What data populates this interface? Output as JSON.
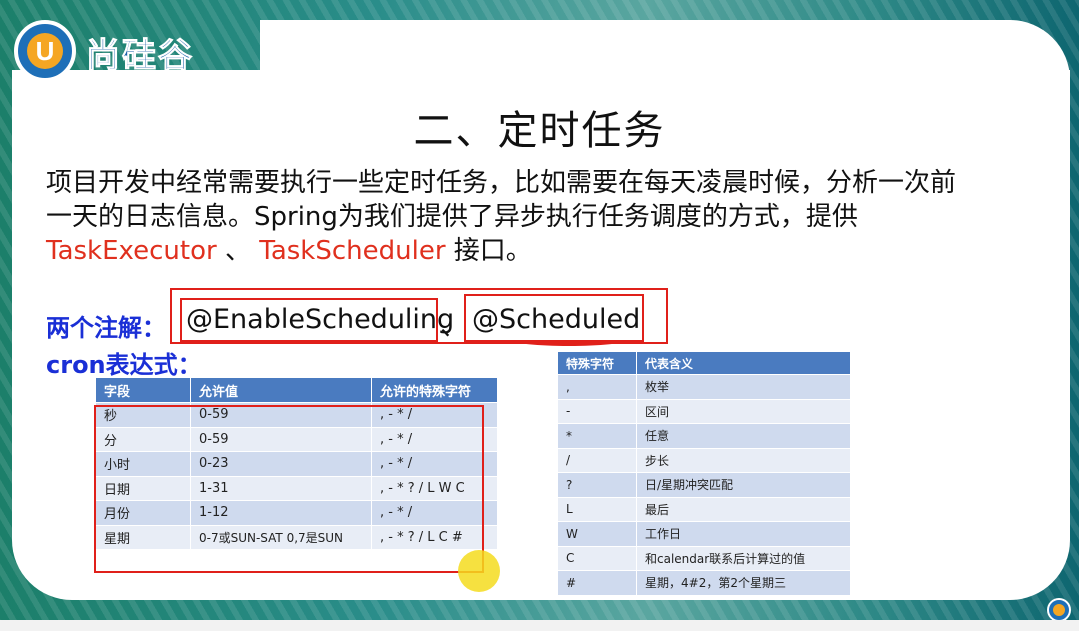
{
  "logo": {
    "badge_letter": "U",
    "name": "尚硅谷",
    "url": "www.atguigu.com"
  },
  "slide": {
    "title": "二、定时任务",
    "paragraph_line1": "项目开发中经常需要执行一些定时任务，比如需要在每天凌晨时候，分析一次前",
    "paragraph_line2": "一天的日志信息。Spring为我们提供了异步执行任务调度的方式，提供",
    "task_executor": "TaskExecutor",
    "separator_mark": " 、",
    "task_scheduler": "TaskScheduler",
    "interface_suffix": " 接口。",
    "annotations_label": "两个注解：",
    "annotation_enable": "@EnableScheduling",
    "annotation_sep": "、",
    "annotation_scheduled": "@Scheduled",
    "cron_label": "cron表达式："
  },
  "cron_table": {
    "headers": [
      "字段",
      "允许值",
      "允许的特殊字符"
    ],
    "rows": [
      [
        "秒",
        "0-59",
        ", - * /"
      ],
      [
        "分",
        "0-59",
        ", - * /"
      ],
      [
        "小时",
        "0-23",
        ", - * /"
      ],
      [
        "日期",
        "1-31",
        ", - * ? / L W C"
      ],
      [
        "月份",
        "1-12",
        ", - * /"
      ],
      [
        "星期",
        "0-7或SUN-SAT 0,7是SUN",
        ", - * ? / L C #"
      ]
    ]
  },
  "special_table": {
    "headers": [
      "特殊字符",
      "代表含义"
    ],
    "rows": [
      [
        ",",
        "枚举"
      ],
      [
        "-",
        "区间"
      ],
      [
        "*",
        "任意"
      ],
      [
        "/",
        "步长"
      ],
      [
        "?",
        "日/星期冲突匹配"
      ],
      [
        "L",
        "最后"
      ],
      [
        "W",
        "工作日"
      ],
      [
        "C",
        "和calendar联系后计算过的值"
      ],
      [
        "#",
        "星期，4#2，第2个星期三"
      ]
    ]
  },
  "colors": {
    "accent_red": "#e0301e",
    "label_blue": "#1a2fd6",
    "table_header": "#4a7bc0",
    "background_teal": "#0f6e78"
  }
}
